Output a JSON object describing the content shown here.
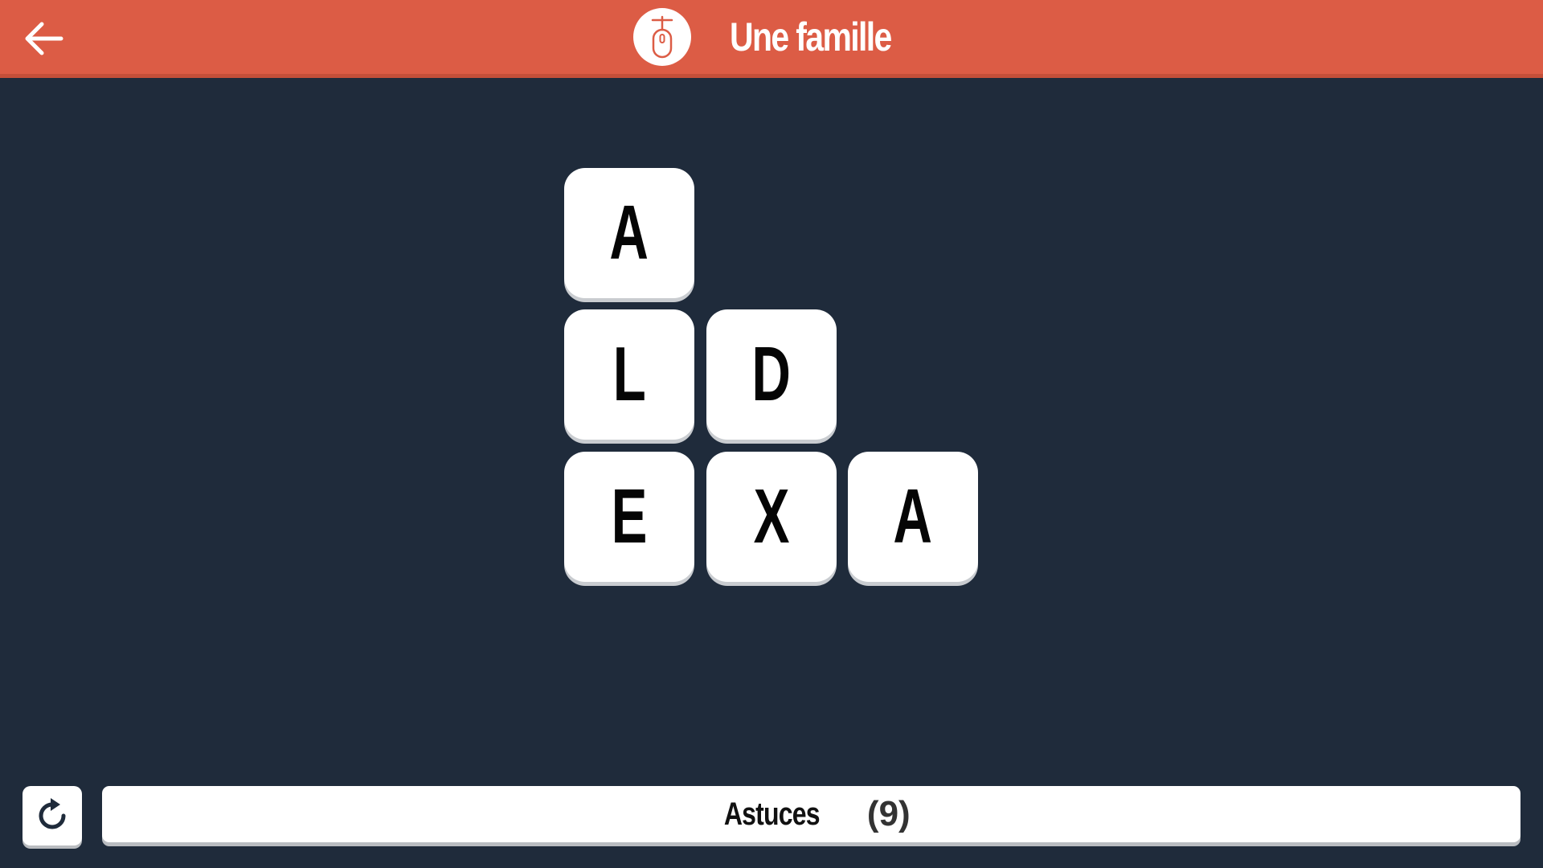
{
  "header": {
    "title": "Une famille",
    "category_icon": "mouse-icon",
    "back_icon": "arrow-left-icon"
  },
  "board": {
    "tiles": [
      {
        "letter": "A",
        "row": 0,
        "col": 0
      },
      {
        "letter": "L",
        "row": 1,
        "col": 0
      },
      {
        "letter": "D",
        "row": 1,
        "col": 1
      },
      {
        "letter": "E",
        "row": 2,
        "col": 0
      },
      {
        "letter": "X",
        "row": 2,
        "col": 1
      },
      {
        "letter": "A",
        "row": 2,
        "col": 2
      }
    ]
  },
  "footer": {
    "reset_icon": "refresh-icon",
    "hints_label": "Astuces",
    "hints_count": "(9)"
  },
  "colors": {
    "header": "#dc5c45",
    "background": "#1f2b3b",
    "tile": "#ffffff"
  }
}
